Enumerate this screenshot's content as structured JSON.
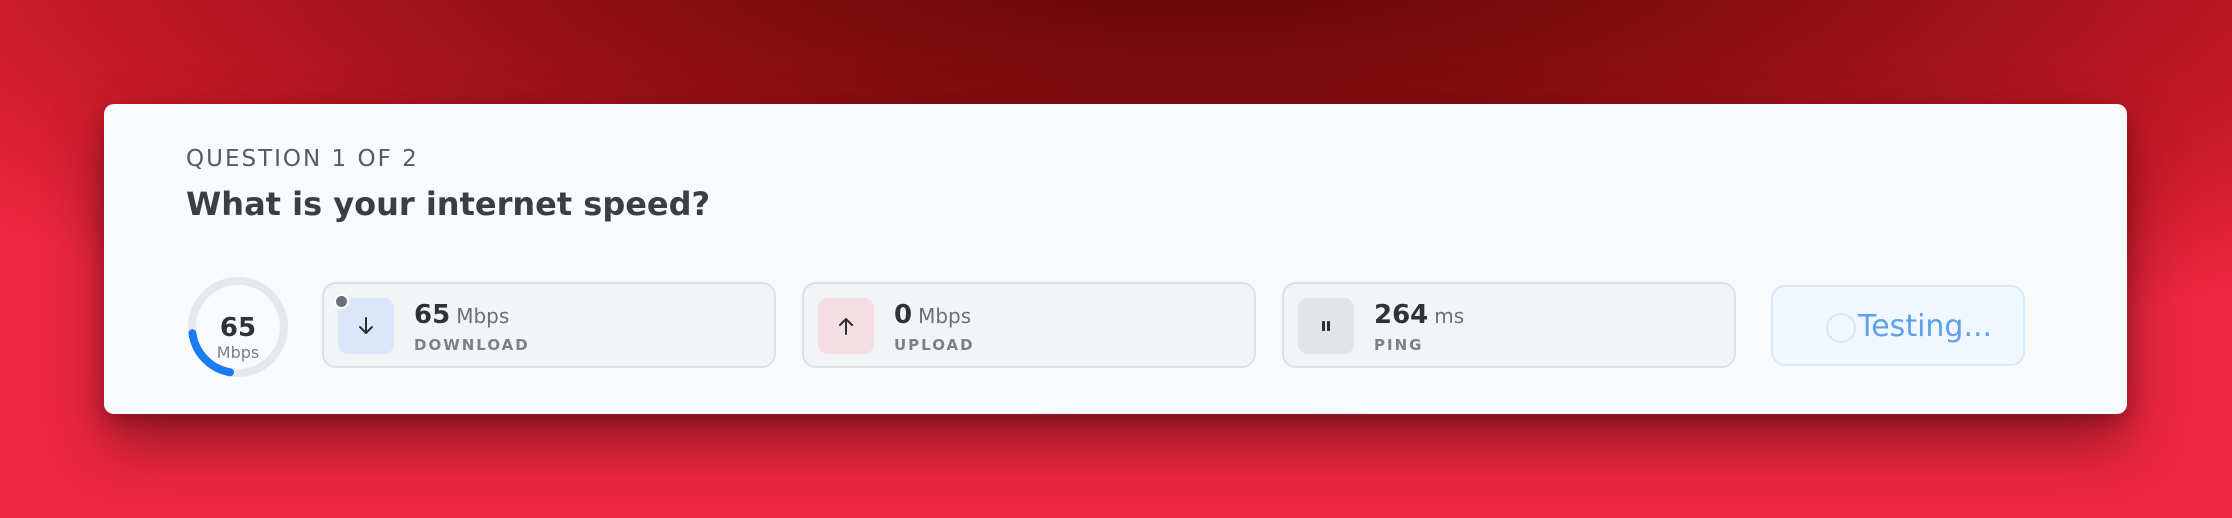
{
  "question": {
    "counter": "QUESTION 1 OF 2",
    "title": "What is your internet speed?"
  },
  "gauge": {
    "value": "65",
    "unit": "Mbps",
    "fill_fraction": 0.2,
    "track_color": "#e6e8eb",
    "fill_color": "#1a7cf0"
  },
  "stats": [
    {
      "value": "65",
      "unit": "Mbps",
      "label": "DOWNLOAD",
      "icon": "arrow-down-icon",
      "icon_bg": "#d9e7f9"
    },
    {
      "value": "0",
      "unit": "Mbps",
      "label": "UPLOAD",
      "icon": "arrow-up-icon",
      "icon_bg": "#f4dde3"
    },
    {
      "value": "264",
      "unit": "ms",
      "label": "PING",
      "icon": "pause-icon",
      "icon_bg": "#e2e4e7"
    }
  ],
  "action": {
    "label": "Testing..."
  }
}
